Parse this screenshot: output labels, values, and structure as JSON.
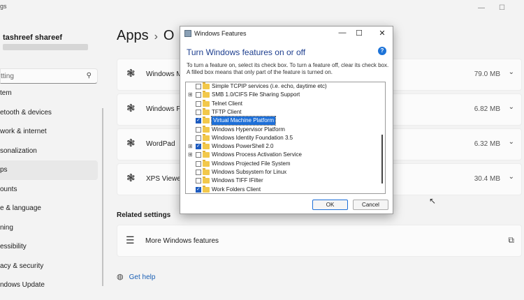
{
  "settings": {
    "title_fragment": "gs",
    "user": {
      "name": "tashreef shareef"
    },
    "search": {
      "placeholder": "tting"
    },
    "nav": [
      {
        "label": "tem"
      },
      {
        "label": "etooth & devices"
      },
      {
        "label": "work & internet"
      },
      {
        "label": "sonalization"
      },
      {
        "label": "ps",
        "active": true
      },
      {
        "label": "ounts"
      },
      {
        "label": "e & language"
      },
      {
        "label": "ning"
      },
      {
        "label": "essibility"
      },
      {
        "label": "acy & security"
      },
      {
        "label": "ndows Update"
      }
    ],
    "breadcrumb": {
      "first": "Apps",
      "second": "O"
    },
    "features": [
      {
        "name": "Windows M",
        "size": "79.0 MB"
      },
      {
        "name": "Windows Po",
        "size": "6.82 MB"
      },
      {
        "name": "WordPad",
        "size": "6.32 MB"
      },
      {
        "name": "XPS Viewer",
        "size": "30.4 MB"
      }
    ],
    "related_title": "Related settings",
    "more_features": "More Windows features",
    "get_help": "Get help"
  },
  "dialog": {
    "title": "Windows Features",
    "heading": "Turn Windows features on or off",
    "description": "To turn a feature on, select its check box. To turn a feature off, clear its check box. A filled box means that only part of the feature is turned on.",
    "items": [
      {
        "label": "Simple TCPIP services (i.e. echo, daytime etc)",
        "checked": false,
        "expandable": false
      },
      {
        "label": "SMB 1.0/CIFS File Sharing Support",
        "checked": false,
        "expandable": true
      },
      {
        "label": "Telnet Client",
        "checked": false,
        "expandable": false
      },
      {
        "label": "TFTP Client",
        "checked": false,
        "expandable": false
      },
      {
        "label": "Virtual Machine Platform",
        "checked": true,
        "expandable": false,
        "selected": true
      },
      {
        "label": "Windows Hypervisor Platform",
        "checked": false,
        "expandable": false
      },
      {
        "label": "Windows Identity Foundation 3.5",
        "checked": false,
        "expandable": false
      },
      {
        "label": "Windows PowerShell 2.0",
        "checked": true,
        "expandable": true
      },
      {
        "label": "Windows Process Activation Service",
        "checked": false,
        "expandable": true
      },
      {
        "label": "Windows Projected File System",
        "checked": false,
        "expandable": false
      },
      {
        "label": "Windows Subsystem for Linux",
        "checked": false,
        "expandable": false
      },
      {
        "label": "Windows TIFF IFilter",
        "checked": false,
        "expandable": false
      },
      {
        "label": "Work Folders Client",
        "checked": true,
        "expandable": false
      }
    ],
    "ok": "OK",
    "cancel": "Cancel"
  }
}
